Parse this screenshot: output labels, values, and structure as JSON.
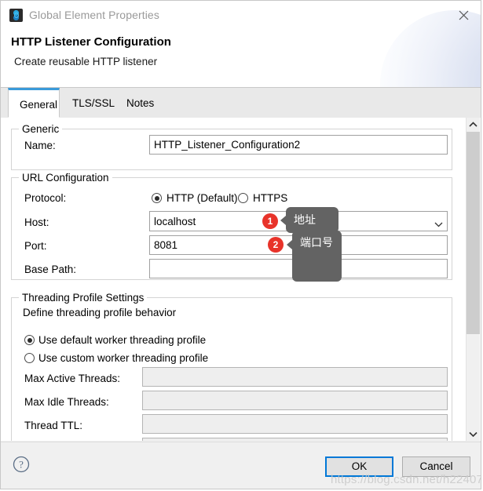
{
  "window": {
    "title": "Global Element Properties",
    "icon": "mule-app-icon",
    "close_icon": "close-icon"
  },
  "header": {
    "title": "HTTP Listener Configuration",
    "subtitle": "Create reusable HTTP listener"
  },
  "tabs": [
    {
      "label": "General",
      "active": true
    },
    {
      "label": "TLS/SSL",
      "active": false
    },
    {
      "label": "Notes",
      "active": false
    }
  ],
  "groups": {
    "generic": {
      "legend": "Generic",
      "name_label": "Name:",
      "name_value": "HTTP_Listener_Configuration2"
    },
    "url_configuration": {
      "legend": "URL Configuration",
      "protocol_label": "Protocol:",
      "protocol_options": [
        {
          "label": "HTTP (Default)",
          "selected": true
        },
        {
          "label": "HTTPS",
          "selected": false
        }
      ],
      "host_label": "Host:",
      "host_value": "localhost",
      "host_dropdown_icon": "chevron-down-icon",
      "port_label": "Port:",
      "port_value": "8081",
      "base_path_label": "Base Path:",
      "base_path_value": ""
    },
    "threading": {
      "legend": "Threading Profile Settings",
      "description": "Define threading profile behavior",
      "profile_options": [
        {
          "label": "Use default worker threading profile",
          "selected": true
        },
        {
          "label": "Use custom worker threading profile",
          "selected": false
        }
      ],
      "fields": [
        {
          "label": "Max Active Threads:",
          "value": "",
          "disabled": true
        },
        {
          "label": "Max Idle Threads:",
          "value": "",
          "disabled": true
        },
        {
          "label": "Thread TTL:",
          "value": "",
          "disabled": true
        }
      ]
    }
  },
  "scrollbar": {
    "up_icon": "chevron-up-icon",
    "down_icon": "chevron-down-icon",
    "thumb_position_percent": 0
  },
  "footer": {
    "help_icon": "help-question-icon",
    "ok_label": "OK",
    "cancel_label": "Cancel"
  },
  "annotations": [
    {
      "badge": "1",
      "text": "地址"
    },
    {
      "badge": "2",
      "text": "端口号"
    }
  ],
  "watermark": "https://blog.csdn.net/h22407",
  "colors": {
    "accent": "#0078d7",
    "tab_accent": "#3a9ad9",
    "annotation_bg": "#636363",
    "badge_red": "#e8332a"
  }
}
